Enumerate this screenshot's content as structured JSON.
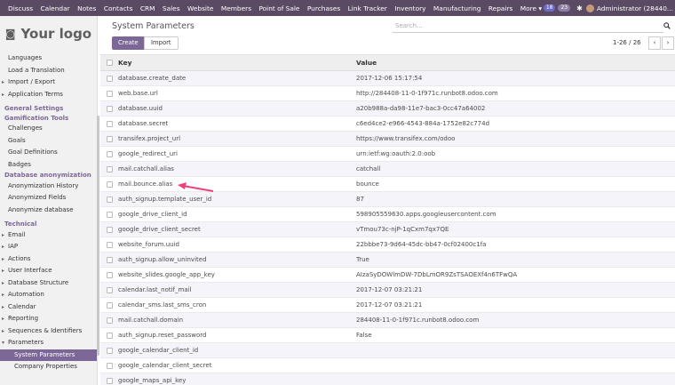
{
  "topbar": {
    "menu": [
      "Discuss",
      "Calendar",
      "Notes",
      "Contacts",
      "CRM",
      "Sales",
      "Website",
      "Members",
      "Point of Sale",
      "Purchases",
      "Link Tracker",
      "Inventory",
      "Manufacturing",
      "Repairs",
      "More ▾"
    ],
    "badge1": "18",
    "badge2": "23",
    "user": "Administrator (28440..."
  },
  "logo": "Your logo",
  "sidebar": {
    "items": [
      {
        "label": "Languages",
        "type": "sub"
      },
      {
        "label": "Load a Translation",
        "type": "sub"
      },
      {
        "label": "Import / Export",
        "type": "caret"
      },
      {
        "label": "Application Terms",
        "type": "caret"
      },
      {
        "label": "",
        "type": "gap"
      },
      {
        "label": "General Settings",
        "type": "head"
      },
      {
        "label": "Gamification Tools",
        "type": "head"
      },
      {
        "label": "Challenges",
        "type": "sub"
      },
      {
        "label": "Goals",
        "type": "sub"
      },
      {
        "label": "Goal Definitions",
        "type": "sub"
      },
      {
        "label": "Badges",
        "type": "sub"
      },
      {
        "label": "Database anonymization",
        "type": "head"
      },
      {
        "label": "Anonymization History",
        "type": "sub"
      },
      {
        "label": "Anonymized Fields",
        "type": "sub"
      },
      {
        "label": "Anonymize database",
        "type": "sub"
      },
      {
        "label": "",
        "type": "gap"
      },
      {
        "label": "Technical",
        "type": "head"
      },
      {
        "label": "Email",
        "type": "caret"
      },
      {
        "label": "IAP",
        "type": "caret"
      },
      {
        "label": "Actions",
        "type": "caret"
      },
      {
        "label": "User Interface",
        "type": "caret"
      },
      {
        "label": "Database Structure",
        "type": "caret"
      },
      {
        "label": "Automation",
        "type": "caret"
      },
      {
        "label": "Calendar",
        "type": "caret"
      },
      {
        "label": "Reporting",
        "type": "caret"
      },
      {
        "label": "Sequences & Identifiers",
        "type": "caret"
      },
      {
        "label": "Parameters",
        "type": "caret-open"
      },
      {
        "label": "System Parameters",
        "type": "active"
      },
      {
        "label": "Company Properties",
        "type": "deep"
      }
    ]
  },
  "control_panel": {
    "title": "System Parameters",
    "create_label": "Create",
    "import_label": "Import",
    "search_placeholder": "Search...",
    "pager": "1-26 / 26",
    "prev": "‹",
    "next": "›"
  },
  "table": {
    "headers": {
      "key": "Key",
      "value": "Value"
    },
    "rows": [
      {
        "key": "database.create_date",
        "value": "2017-12-06 15:17:54"
      },
      {
        "key": "web.base.url",
        "value": "http://284408-11-0-1f971c.runbot8.odoo.com"
      },
      {
        "key": "database.uuid",
        "value": "a20b988a-da98-11e7-bac3-0cc47a64002"
      },
      {
        "key": "database.secret",
        "value": "c6ed4ce2-e966-4543-884a-1752e82c774d"
      },
      {
        "key": "transifex.project_url",
        "value": "https://www.transifex.com/odoo"
      },
      {
        "key": "google_redirect_uri",
        "value": "urn:ietf:wg:oauth:2.0:oob"
      },
      {
        "key": "mail.catchall.alias",
        "value": "catchall"
      },
      {
        "key": "mail.bounce.alias",
        "value": "bounce"
      },
      {
        "key": "auth_signup.template_user_id",
        "value": "87"
      },
      {
        "key": "google_drive_client_id",
        "value": "598905559630.apps.googleusercontent.com"
      },
      {
        "key": "google_drive_client_secret",
        "value": "vTmou73c-njP-1qCxm7qx7QE"
      },
      {
        "key": "website_forum.uuid",
        "value": "22bbbe73-9d64-45dc-bb47-0cf02400c1fa"
      },
      {
        "key": "auth_signup.allow_uninvited",
        "value": "True"
      },
      {
        "key": "website_slides.google_app_key",
        "value": "AIzaSyDOWlmDW-7DbLmOR9ZsTSAOEXf4n6TFwQA"
      },
      {
        "key": "calendar.last_notif_mail",
        "value": "2017-12-07 03:21:21"
      },
      {
        "key": "calendar_sms.last_sms_cron",
        "value": "2017-12-07 03:21:21"
      },
      {
        "key": "mail.catchall.domain",
        "value": "284408-11-0-1f971c.runbot8.odoo.com"
      },
      {
        "key": "auth_signup.reset_password",
        "value": "False"
      },
      {
        "key": "google_calendar_client_id",
        "value": ""
      },
      {
        "key": "google_calendar_client_secret",
        "value": ""
      },
      {
        "key": "google_maps_api_key",
        "value": ""
      }
    ]
  },
  "colors": {
    "navbar": "#5b4a63",
    "accent": "#7c6897",
    "annotation_arrow": "#f0407a"
  }
}
